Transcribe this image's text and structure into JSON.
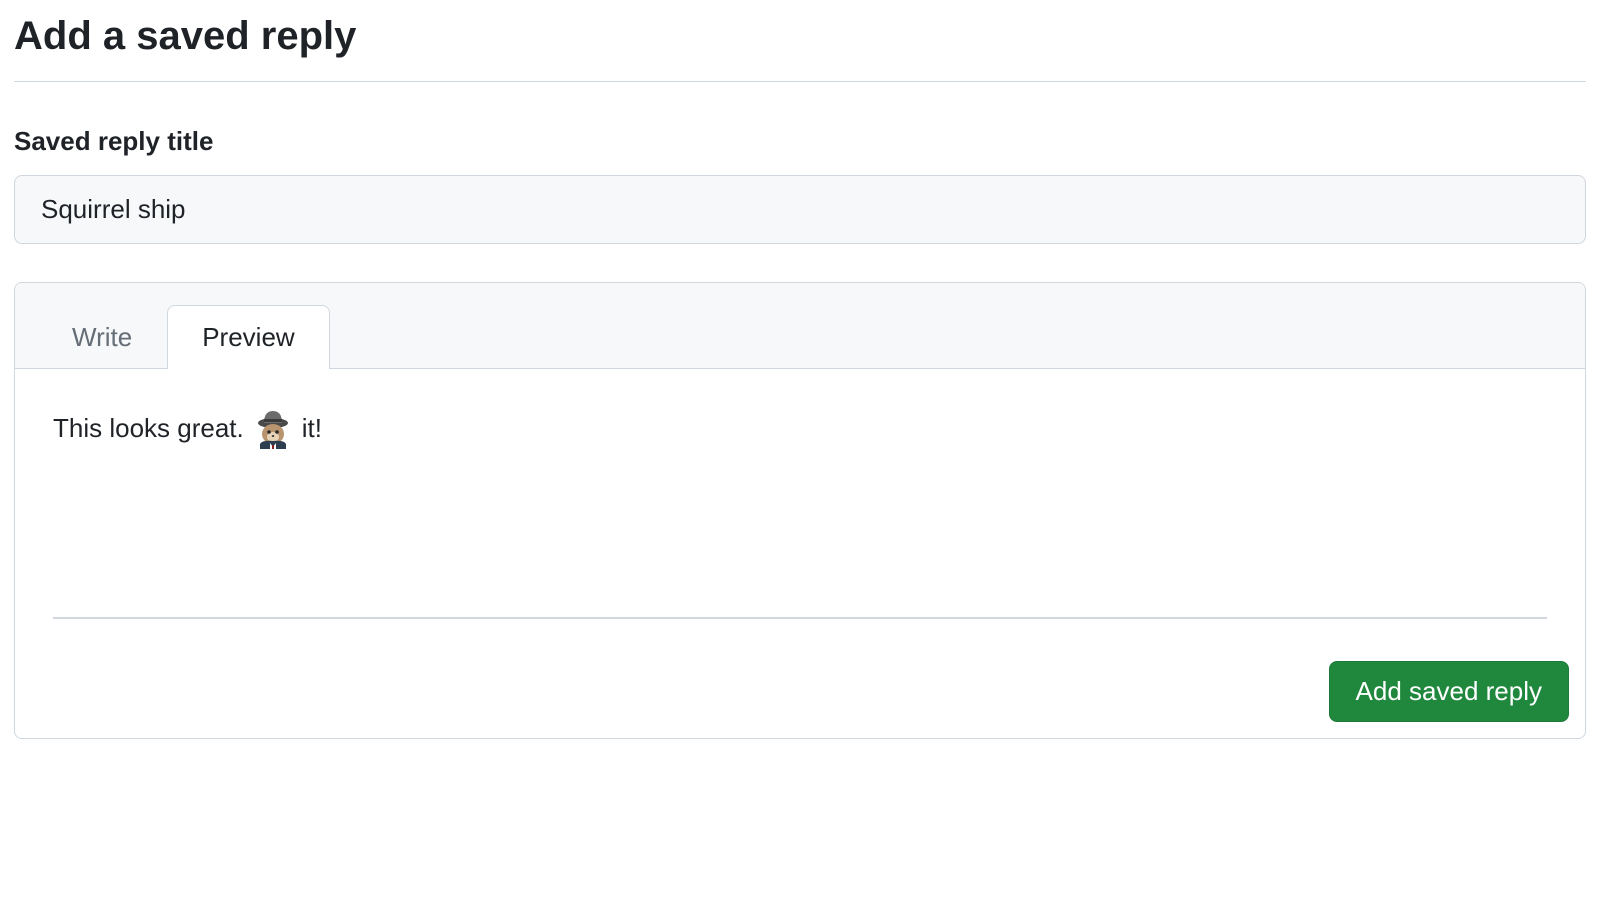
{
  "page": {
    "title": "Add a saved reply"
  },
  "form": {
    "title_label": "Saved reply title",
    "title_value": "Squirrel ship"
  },
  "tabs": {
    "write": "Write",
    "preview": "Preview",
    "active": "preview"
  },
  "preview": {
    "text_before": "This looks great.",
    "emoji_name": "shipit-squirrel",
    "text_after": "it!"
  },
  "actions": {
    "submit_label": "Add saved reply"
  }
}
